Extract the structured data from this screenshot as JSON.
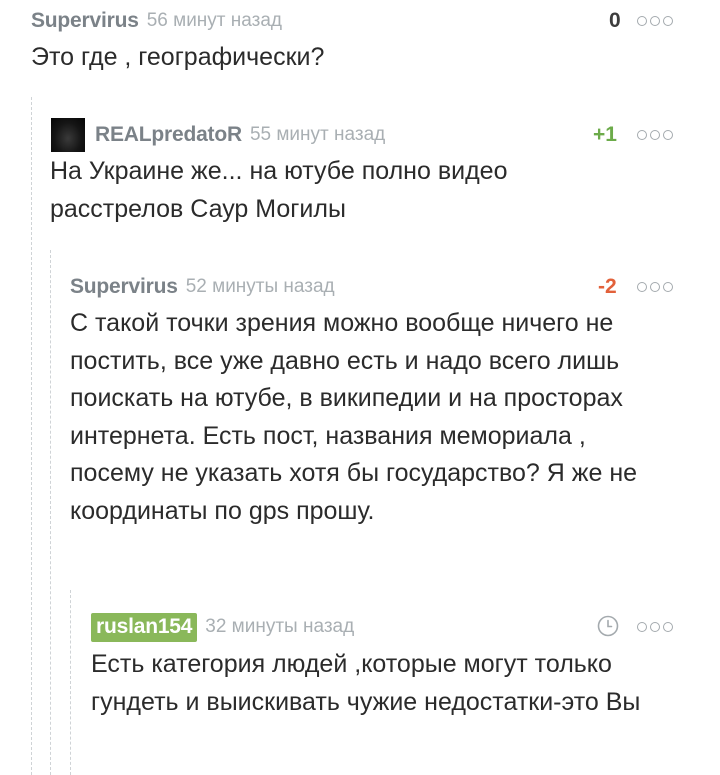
{
  "comments": [
    {
      "author": "Supervirus",
      "time": "56 минут назад",
      "rating": "0",
      "text": "Это где , географически?"
    },
    {
      "author": "REALpredatoR",
      "time": "55 минут назад",
      "rating": "+1",
      "text": "На Украине же... на ютубе полно видео расстрелов Саур Могилы"
    },
    {
      "author": "Supervirus",
      "time": "52 минуты назад",
      "rating": "-2",
      "text": "С такой точки зрения можно вообще ничего не постить, все уже давно есть и надо всего лишь поискать на ютубе, в википедии и на просторах интернета. Есть пост, названия мемориала , посему не указать хотя бы государство? Я же не координаты по gps прошу."
    },
    {
      "author": "ruslan154",
      "time": "32 минуты назад",
      "text": "Есть категория людей ,которые могут только гундеть и выискивать чужие недостатки-это Вы"
    }
  ],
  "colors": {
    "positive": "#6cab4a",
    "negative": "#e2613a",
    "neutral": "#3d3d3d",
    "author_badge": "#8ab85a"
  },
  "icons": {
    "more": "more-dots-icon",
    "clock": "clock-icon",
    "avatar": "user-avatar"
  }
}
